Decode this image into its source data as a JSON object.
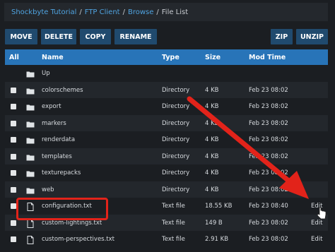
{
  "breadcrumb": [
    {
      "label": "Shockbyte Tutorial",
      "link": true
    },
    {
      "label": "FTP Client",
      "link": true
    },
    {
      "label": "Browse",
      "link": true
    },
    {
      "label": "File List",
      "link": false
    }
  ],
  "breadcrumb_separator": "/",
  "toolbar": {
    "move": "MOVE",
    "delete": "DELETE",
    "copy": "COPY",
    "rename": "RENAME",
    "zip": "ZIP",
    "unzip": "UNZIP"
  },
  "table": {
    "headers": {
      "all": "All",
      "name": "Name",
      "type": "Type",
      "size": "Size",
      "mod_time": "Mod Time"
    },
    "rows": [
      {
        "name": "Up",
        "type": "",
        "size": "",
        "mod": "",
        "kind": "folder",
        "checkbox": false,
        "edit": ""
      },
      {
        "name": "colorschemes",
        "type": "Directory",
        "size": "4 KB",
        "mod": "Feb 23 08:02",
        "kind": "folder",
        "checkbox": true,
        "edit": ""
      },
      {
        "name": "export",
        "type": "Directory",
        "size": "4 KB",
        "mod": "Feb 23 08:02",
        "kind": "folder",
        "checkbox": true,
        "edit": ""
      },
      {
        "name": "markers",
        "type": "Directory",
        "size": "4 KB",
        "mod": "Feb 23 08:02",
        "kind": "folder",
        "checkbox": true,
        "edit": ""
      },
      {
        "name": "renderdata",
        "type": "Directory",
        "size": "4 KB",
        "mod": "Feb 23 08:02",
        "kind": "folder",
        "checkbox": true,
        "edit": ""
      },
      {
        "name": "templates",
        "type": "Directory",
        "size": "4 KB",
        "mod": "Feb 23 08:02",
        "kind": "folder",
        "checkbox": true,
        "edit": ""
      },
      {
        "name": "texturepacks",
        "type": "Directory",
        "size": "4 KB",
        "mod": "Feb 23 08:02",
        "kind": "folder",
        "checkbox": true,
        "edit": ""
      },
      {
        "name": "web",
        "type": "Directory",
        "size": "4 KB",
        "mod": "Feb 23 08:02",
        "kind": "folder",
        "checkbox": true,
        "edit": ""
      },
      {
        "name": "configuration.txt",
        "type": "Text file",
        "size": "18.55 KB",
        "mod": "Feb 23 08:40",
        "kind": "file",
        "checkbox": true,
        "edit": "Edit"
      },
      {
        "name": "custom-lightings.txt",
        "type": "Text file",
        "size": "149 B",
        "mod": "Feb 23 08:02",
        "kind": "file",
        "checkbox": true,
        "edit": "Edit"
      },
      {
        "name": "custom-perspectives.txt",
        "type": "Text file",
        "size": "2.91 KB",
        "mod": "Feb 23 08:02",
        "kind": "file",
        "checkbox": true,
        "edit": "Edit"
      }
    ]
  },
  "icons": {
    "folder": "folder-icon",
    "file": "file-icon",
    "cursor": "hand-pointer-icon"
  },
  "colors": {
    "background": "#1b1e22",
    "header": "#2874b8",
    "button": "#204a6e",
    "link": "#4fa3e0",
    "annotation": "#e2231a"
  }
}
